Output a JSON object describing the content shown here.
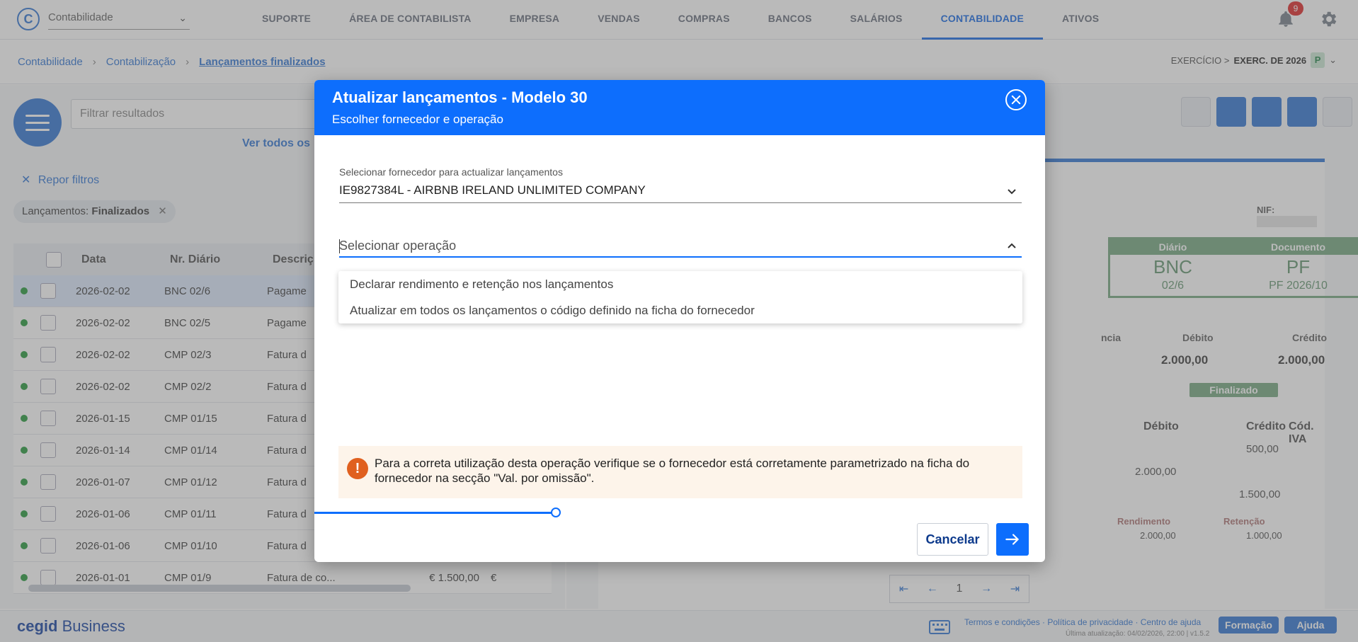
{
  "topbar": {
    "module_value": "Contabilidade",
    "nav": [
      "SUPORTE",
      "ÁREA DE CONTABILISTA",
      "EMPRESA",
      "VENDAS",
      "COMPRAS",
      "BANCOS",
      "SALÁRIOS",
      "CONTABILIDADE",
      "ATIVOS"
    ],
    "active_nav": "CONTABILIDADE",
    "notifications_count": "9"
  },
  "breadcrumb": {
    "items": [
      "Contabilidade",
      "Contabilização",
      "Lançamentos finalizados"
    ],
    "exercise_label": "EXERCÍCIO >",
    "exercise_value": "EXERC. DE 2026",
    "exercise_badge": "P"
  },
  "list": {
    "filter_placeholder": "Filtrar resultados",
    "see_all": "Ver todos os",
    "reset_filters": "Repor filtros",
    "chip_label": "Lançamentos:",
    "chip_value": "Finalizados",
    "headers": [
      "Data",
      "Nr. Diário",
      "Descriç"
    ],
    "rows": [
      {
        "date": "2026-02-02",
        "diary": "BNC 02/6",
        "desc": "Pagame"
      },
      {
        "date": "2026-02-02",
        "diary": "BNC 02/5",
        "desc": "Pagame"
      },
      {
        "date": "2026-02-02",
        "diary": "CMP 02/3",
        "desc": "Fatura d"
      },
      {
        "date": "2026-02-02",
        "diary": "CMP 02/2",
        "desc": "Fatura d"
      },
      {
        "date": "2026-01-15",
        "diary": "CMP 01/15",
        "desc": "Fatura d"
      },
      {
        "date": "2026-01-14",
        "diary": "CMP 01/14",
        "desc": "Fatura d"
      },
      {
        "date": "2026-01-07",
        "diary": "CMP 01/12",
        "desc": "Fatura d"
      },
      {
        "date": "2026-01-06",
        "diary": "CMP 01/11",
        "desc": "Fatura d"
      },
      {
        "date": "2026-01-06",
        "diary": "CMP 01/10",
        "desc": "Fatura d"
      },
      {
        "date": "2026-01-01",
        "diary": "CMP 01/9",
        "desc": "Fatura de co...",
        "amount": "€ 1.500,00",
        "currency": "€"
      }
    ]
  },
  "document": {
    "nif_label": "NIF:",
    "diary_header": "Diário",
    "document_header": "Documento",
    "diary_code": "BNC",
    "diary_number": "02/6",
    "document_code": "PF",
    "document_number": "PF 2026/10",
    "ref_label": "ncia",
    "debit_label": "Débito",
    "credit_label": "Crédito",
    "debit_total": "2.000,00",
    "credit_total": "2.000,00",
    "status": "Finalizado",
    "lines_headers": [
      "Débito",
      "Crédito",
      "Cód. IVA"
    ],
    "lines": [
      {
        "debit": "",
        "credit": "500,00"
      },
      {
        "debit": "2.000,00",
        "credit": ""
      },
      {
        "debit": "",
        "credit": "1.500,00"
      }
    ],
    "retention_headers": [
      "Rendimento",
      "Retenção"
    ],
    "retention_values": [
      "2.000,00",
      "1.000,00"
    ],
    "page": "1"
  },
  "footer": {
    "brand_prefix": "cegid",
    "brand_suffix": "Business",
    "links": "Termos e condições · Política de privacidade · Centro de ajuda",
    "last_update": "Última atualização: 04/02/2026, 22:00 | v1.5.2",
    "training": "Formação",
    "help": "Ajuda"
  },
  "modal": {
    "title": "Atualizar lançamentos - Modelo 30",
    "subtitle": "Escolher fornecedor e operação",
    "supplier_label": "Selecionar fornecedor para actualizar lançamentos",
    "supplier_value": "IE9827384L - AIRBNB IRELAND UNLIMITED COMPANY",
    "operation_placeholder": "Selecionar operação",
    "options": [
      "Declarar rendimento e retenção nos lançamentos",
      "Atualizar em todos os lançamentos o código definido na ficha do fornecedor"
    ],
    "warning_icon": "!",
    "warning_text": "Para a correta utilização desta operação verifique se o fornecedor está corretamente parametrizado na ficha do fornecedor na secção \"Val. por omissão\".",
    "progress": 0.33,
    "cancel_label": "Cancelar"
  },
  "colors": {
    "primary": "#0d6efd",
    "link": "#3a7bd5",
    "success": "#7aab86",
    "warning_icon": "#e0601f",
    "warning_bg": "#fdf4ea"
  }
}
